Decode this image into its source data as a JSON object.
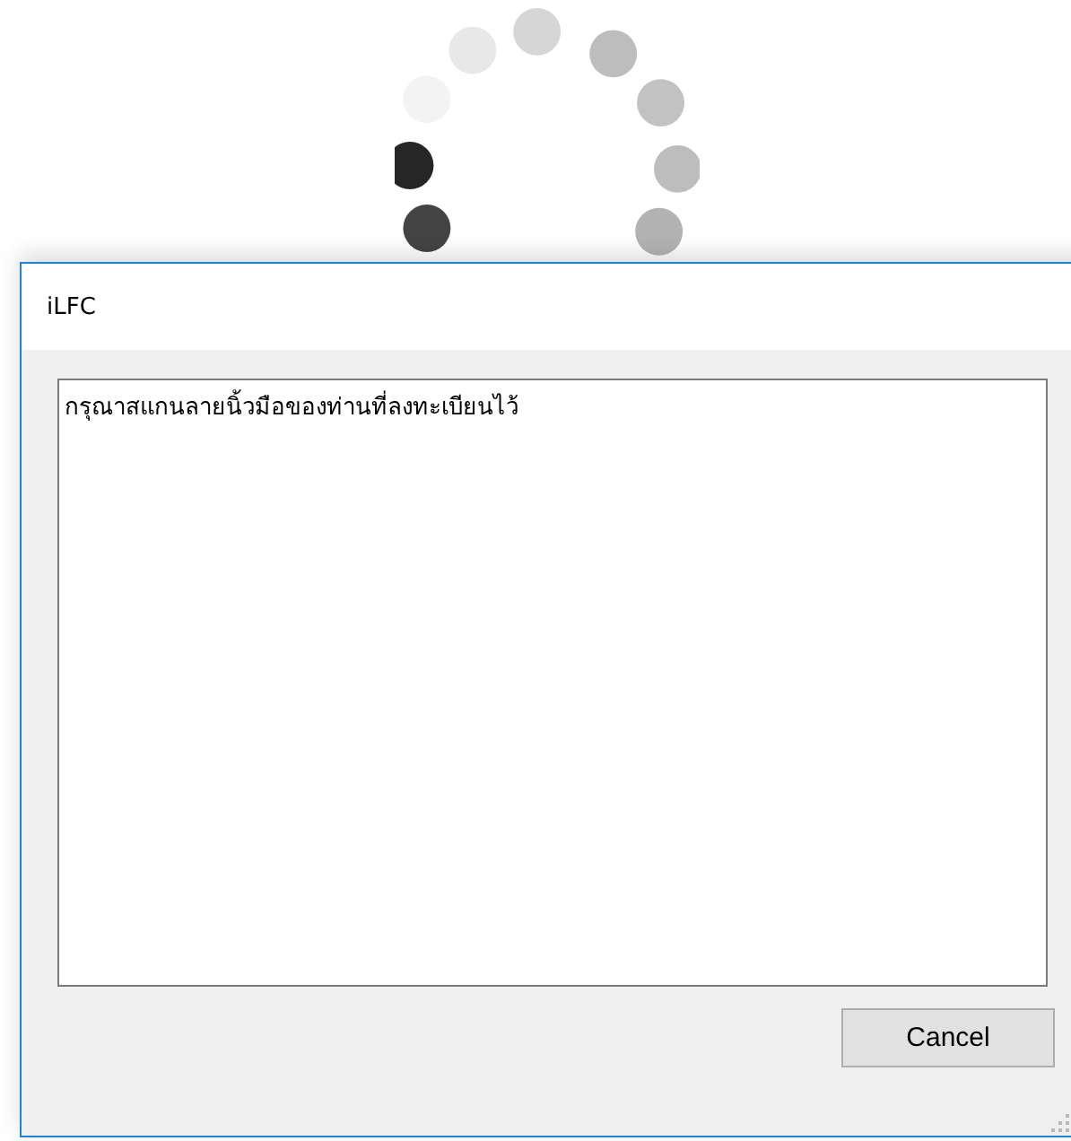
{
  "window": {
    "title": "iLFC"
  },
  "message": "กรุณาสแกนลายนิ้วมือของท่านที่ลงทะเบียนไว้",
  "buttons": [
    {
      "label": "Cancel"
    }
  ]
}
